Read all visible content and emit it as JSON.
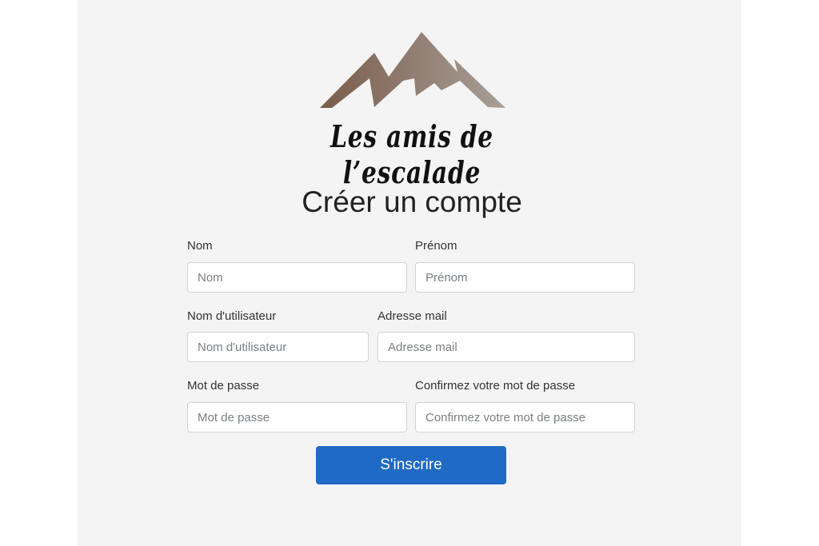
{
  "brand": {
    "logo_icon": "mountain-icon",
    "name": "Les amis de l’escalade",
    "colors": {
      "mountain_dark": "#7a5c4b",
      "mountain_light": "#a89f98"
    }
  },
  "page_title": "Créer un compte",
  "form": {
    "last_name": {
      "label": "Nom",
      "placeholder": "Nom",
      "value": ""
    },
    "first_name": {
      "label": "Prénom",
      "placeholder": "Prénom",
      "value": ""
    },
    "username": {
      "label": "Nom d'utilisateur",
      "placeholder": "Nom d'utilisateur",
      "value": ""
    },
    "email": {
      "label": "Adresse mail",
      "placeholder": "Adresse mail",
      "value": ""
    },
    "password": {
      "label": "Mot de passe",
      "placeholder": "Mot de passe",
      "value": ""
    },
    "confirm_password": {
      "label": "Confirmez votre mot de passe",
      "placeholder": "Confirmez votre mot de passe",
      "value": ""
    },
    "submit_label": "S'inscrire",
    "submit_color": "#1f6ac4"
  }
}
